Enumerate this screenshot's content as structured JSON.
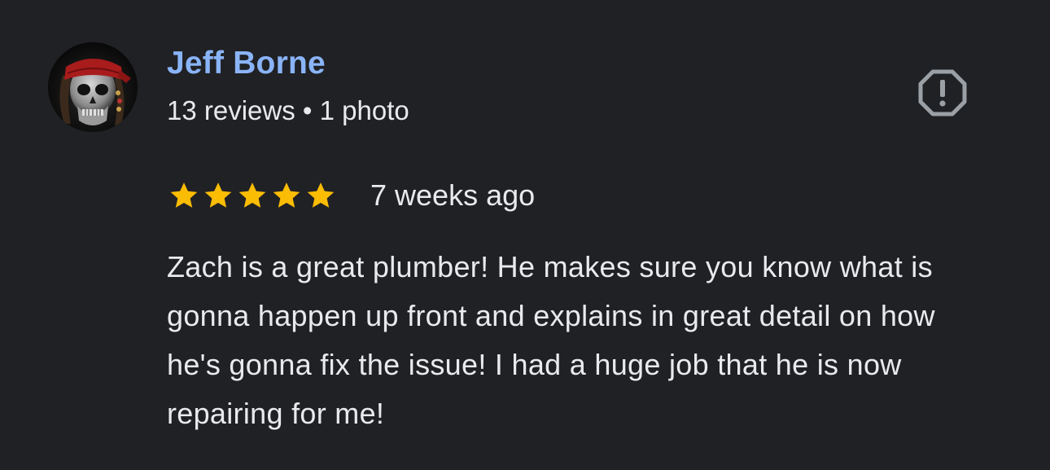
{
  "review": {
    "author": {
      "name": "Jeff Borne",
      "meta": "13 reviews • 1 photo",
      "avatar_icon": "pirate-skull-avatar"
    },
    "report_icon": "report-flag-icon",
    "rating": {
      "stars": 5,
      "max": 5,
      "star_color": "#fbbc04"
    },
    "date": "7 weeks ago",
    "text": "Zach is a great plumber! He makes sure you know what is gonna happen up front and explains in great detail on how he's gonna fix the issue! I had a huge job that he is now repairing for me!"
  },
  "colors": {
    "background": "#202124",
    "name": "#8ab4f8",
    "text": "#e8eaed",
    "icon": "#9aa0a6"
  }
}
